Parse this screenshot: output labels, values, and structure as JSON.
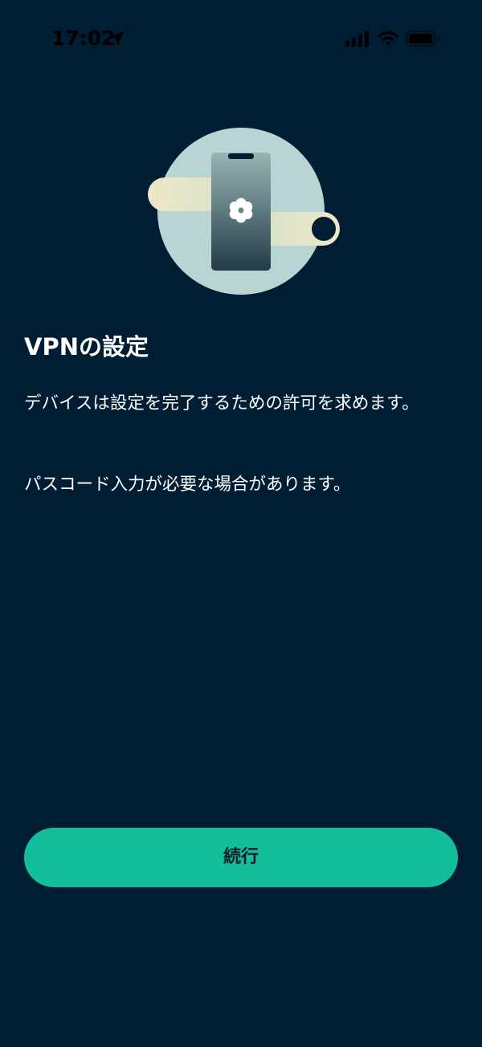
{
  "status_bar": {
    "time": "17:02",
    "icons": [
      "location-arrow-icon",
      "cellular-signal-icon",
      "wifi-icon",
      "battery-icon"
    ]
  },
  "illustration": {
    "name": "phone-settings-illustration",
    "icons": [
      "phone-icon",
      "gear-icon"
    ]
  },
  "content": {
    "title": "VPNの設定",
    "description_1": "デバイスは設定を完了するための許可を求めます。",
    "description_2": "パスコード入力が必要な場合があります。"
  },
  "actions": {
    "continue_label": "続行"
  },
  "colors": {
    "background": "#001e33",
    "accent": "#14bd9c",
    "illustration_circle": "#b9d5d3",
    "illustration_band": "#efe8c8"
  }
}
